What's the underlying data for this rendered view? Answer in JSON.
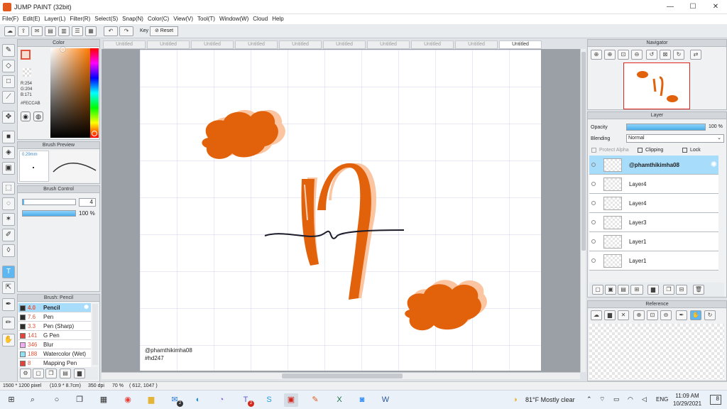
{
  "window": {
    "title": "JUMP PAINT (32bit)"
  },
  "menu": [
    "File(F)",
    "Edit(E)",
    "Layer(L)",
    "Filter(R)",
    "Select(S)",
    "Snap(N)",
    "Color(C)",
    "View(V)",
    "Tool(T)",
    "Window(W)",
    "Cloud",
    "Help"
  ],
  "toolbar": {
    "key_label": "Key",
    "reset_label": "Reset"
  },
  "color_panel": {
    "title": "Color",
    "r": "R:254",
    "g": "G:204",
    "b": "B:171",
    "hex": "#FECCAB",
    "current_color": "#FECCAB"
  },
  "brush_preview": {
    "title": "Brush Preview",
    "size_label": "0.29mm"
  },
  "brush_control": {
    "title": "Brush Control",
    "size_value": "4",
    "opacity_value": "100 %"
  },
  "brush_list": {
    "title": "Brush: Pencil",
    "items": [
      {
        "size": "4.0",
        "name": "Pencil",
        "color": "#2d2d2d"
      },
      {
        "size": "7.6",
        "name": "Pen",
        "color": "#2d2d2d"
      },
      {
        "size": "3.3",
        "name": "Pen (Sharp)",
        "color": "#2d2d2d"
      },
      {
        "size": "141",
        "name": "G Pen",
        "color": "#e8413a"
      },
      {
        "size": "346",
        "name": "Blur",
        "color": "#f3a9f1"
      },
      {
        "size": "188",
        "name": "Watercolor (Wet)",
        "color": "#8fe2f4"
      },
      {
        "size": "8",
        "name": "Mapping Pen",
        "color": "#e8413a"
      }
    ]
  },
  "doc_tabs": [
    "Untitled",
    "Untitled",
    "Untitled",
    "Untitled",
    "Untitled",
    "Untitled",
    "Untitled",
    "Untitled",
    "Untitled",
    "Untitled"
  ],
  "canvas": {
    "signature_line1": "@phamthikimha08",
    "signature_line2": "#hd247",
    "accent": "#e2620c",
    "shadow": "#fbc5a2"
  },
  "navigator": {
    "title": "Navigator"
  },
  "layer_panel": {
    "title": "Layer",
    "opacity_label": "Opacity",
    "opacity_value": "100 %",
    "blending_label": "Blending",
    "blending_value": "Normal",
    "protect_alpha": "Protect Alpha",
    "clipping": "Clipping",
    "lock": "Lock",
    "layers": [
      "@phamthikimha08",
      "Layer4",
      "Layer4",
      "Layer3",
      "Layer1",
      "Layer1"
    ]
  },
  "reference": {
    "title": "Reference"
  },
  "status": {
    "pixels": "1500 * 1200 pixel",
    "size_cm": "(10.9 * 8.7cm)",
    "dpi": "350 dpi",
    "zoom": "70 %",
    "coords": "( 612, 1047 )"
  },
  "taskbar": {
    "weather": "81°F Mostly clear",
    "lang": "ENG",
    "time": "11:09 AM",
    "date": "10/29/2021",
    "notif": "8",
    "mail_badge": "2",
    "teams_badge": "2"
  }
}
